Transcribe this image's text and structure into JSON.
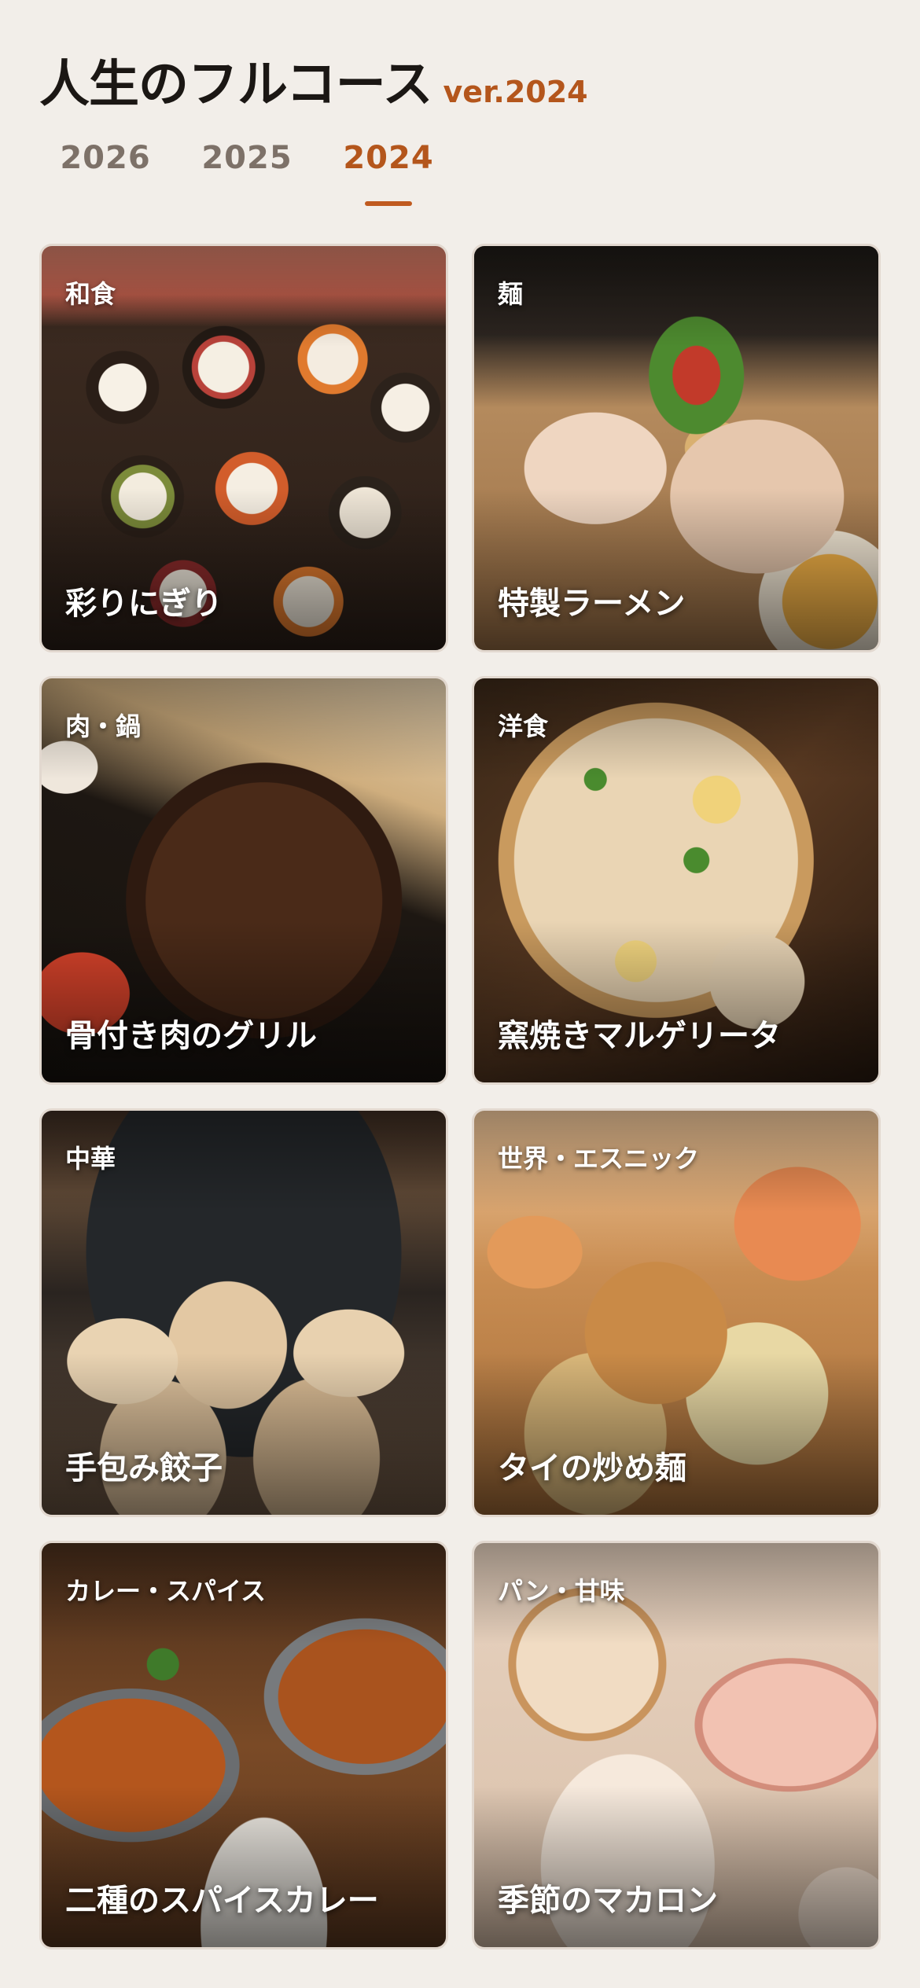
{
  "header": {
    "title": "人生のフルコース",
    "version": "ver.2024"
  },
  "tabs": [
    {
      "label": "2026",
      "active": false
    },
    {
      "label": "2025",
      "active": false
    },
    {
      "label": "2024",
      "active": true
    }
  ],
  "colors": {
    "background": "#f2eee9",
    "accent": "#b4561c",
    "tab_inactive": "#7d7168",
    "title": "#1b1714"
  },
  "cards": [
    {
      "category": "和食",
      "name": "彩りにぎり"
    },
    {
      "category": "麺",
      "name": "特製ラーメン"
    },
    {
      "category": "肉・鍋",
      "name": "骨付き肉のグリル"
    },
    {
      "category": "洋食",
      "name": "窯焼きマルゲリータ"
    },
    {
      "category": "中華",
      "name": "手包み餃子"
    },
    {
      "category": "世界・エスニック",
      "name": "タイの炒め麺"
    },
    {
      "category": "カレー・スパイス",
      "name": "二種のスパイスカレー"
    },
    {
      "category": "パン・甘味",
      "name": "季節のマカロン"
    }
  ]
}
